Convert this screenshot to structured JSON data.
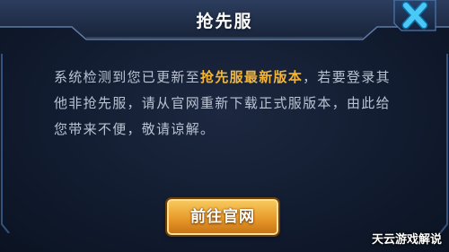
{
  "dialog": {
    "title": "抢先服",
    "message_part1": "系统检测到您已更新至",
    "message_highlight": "抢先服最新版本",
    "message_part2": "，若要登录其他非抢先服，请从官网重新下载正式服版本，由此给您带来不便，敬请谅解。",
    "button_label": "前往官网"
  },
  "icons": {
    "close": "close-x-icon"
  },
  "colors": {
    "highlight": "#f2b53a",
    "body_text": "#b9c3d3",
    "button": "#e89a2a",
    "close_icon": "#3fc0f0"
  },
  "watermark": "天云游戏解说"
}
